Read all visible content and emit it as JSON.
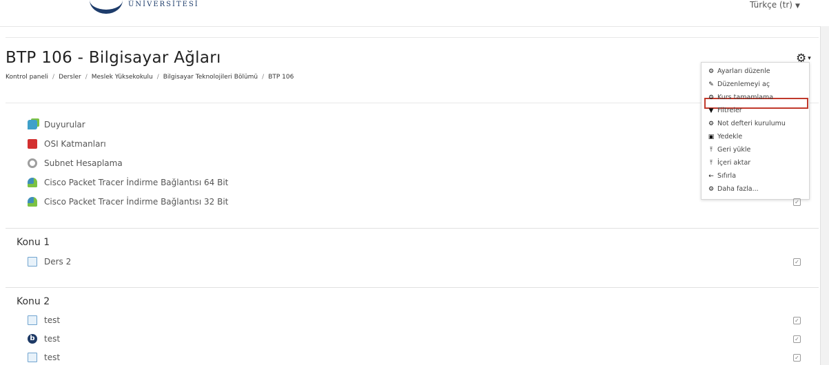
{
  "header": {
    "logo_text": "ÜNİVERSİTESİ",
    "language": "Türkçe (tr)"
  },
  "course": {
    "title": "BTP 106 - Bilgisayar Ağları",
    "breadcrumb": [
      "Kontrol paneli",
      "Dersler",
      "Meslek Yüksekokulu",
      "Bilgisayar Teknolojileri Bölümü",
      "BTP 106"
    ]
  },
  "actions_menu": {
    "items": [
      {
        "label": "Ayarları düzenle",
        "icon": "gear-icon"
      },
      {
        "label": "Düzenlemeyi aç",
        "icon": "pencil-icon",
        "highlighted": true
      },
      {
        "label": "Kurs tamamlama",
        "icon": "gear-icon"
      },
      {
        "label": "Filtreler",
        "icon": "filter-icon"
      },
      {
        "label": "Not defteri kurulumu",
        "icon": "gear-icon"
      },
      {
        "label": "Yedekle",
        "icon": "backup-icon"
      },
      {
        "label": "Geri yükle",
        "icon": "upload-icon"
      },
      {
        "label": "İçeri aktar",
        "icon": "import-icon"
      },
      {
        "label": "Sıfırla",
        "icon": "arrow-left-icon"
      },
      {
        "label": "Daha fazla...",
        "icon": "gear-icon"
      }
    ],
    "highlight_color": "#c0392b"
  },
  "sections": [
    {
      "title": "",
      "resources": [
        {
          "label": "Duyurular",
          "icon": "forum-icon"
        },
        {
          "label": "OSI Katmanları",
          "icon": "pdf-icon"
        },
        {
          "label": "Subnet Hesaplama",
          "icon": "url-icon"
        },
        {
          "label": "Cisco Packet Tracer İndirme Bağlantısı 64 Bit",
          "icon": "file-icon"
        },
        {
          "label": "Cisco Packet Tracer İndirme Bağlantısı 32 Bit",
          "icon": "file-icon"
        }
      ]
    },
    {
      "title": "Konu 1",
      "resources": [
        {
          "label": "Ders 2",
          "icon": "page-icon"
        }
      ]
    },
    {
      "title": "Konu 2",
      "resources": [
        {
          "label": "test",
          "icon": "page-icon"
        },
        {
          "label": "test",
          "icon": "bigbluebutton-icon"
        },
        {
          "label": "test",
          "icon": "page-icon"
        }
      ]
    }
  ]
}
